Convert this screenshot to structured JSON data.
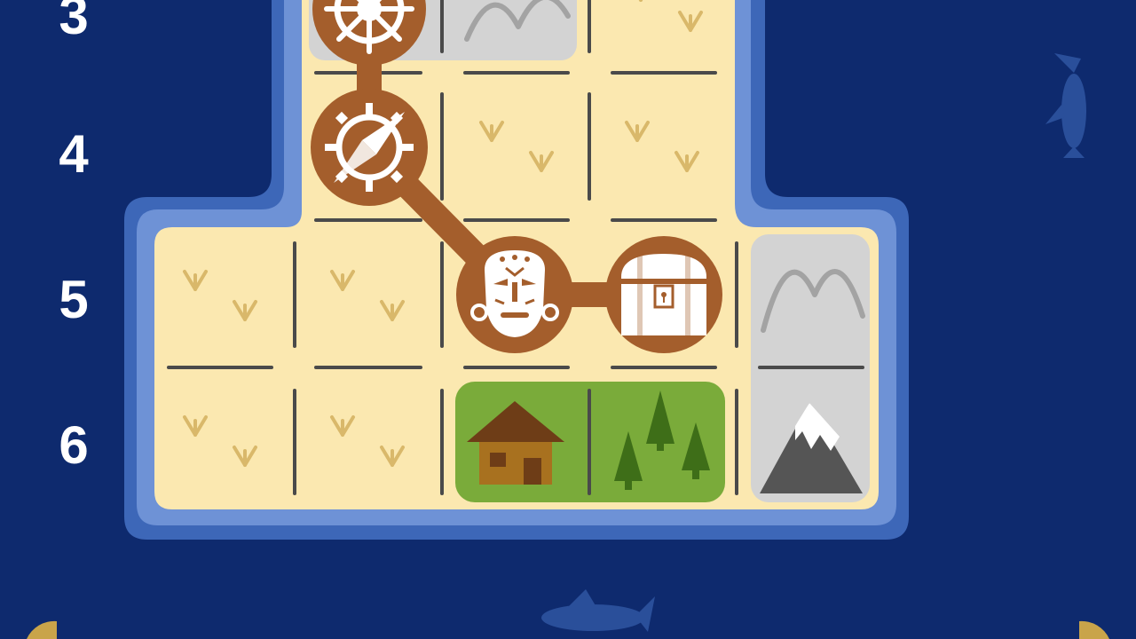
{
  "row_labels": [
    "3",
    "4",
    "5",
    "6"
  ],
  "board": {
    "grid_tiles": [
      {
        "row": "3",
        "col": 2,
        "terrain": "grass"
      },
      {
        "row": "4",
        "col": 2,
        "terrain": "grass"
      },
      {
        "row": "4",
        "col": 3,
        "terrain": "grass"
      },
      {
        "row": "5",
        "col": 0,
        "terrain": "grass"
      },
      {
        "row": "5",
        "col": 1,
        "terrain": "grass"
      },
      {
        "row": "6",
        "col": 0,
        "terrain": "grass"
      },
      {
        "row": "6",
        "col": 1,
        "terrain": "grass"
      }
    ],
    "regions": [
      {
        "name": "mountains",
        "terrain": "mountain",
        "color": "#d3d3d3"
      },
      {
        "name": "forest",
        "terrain": "forest",
        "color": "#7aab3a"
      }
    ],
    "path_nodes": [
      {
        "row": "3",
        "col": 0,
        "icon": "ships-wheel-icon"
      },
      {
        "row": "4",
        "col": 0,
        "icon": "compass-icon"
      },
      {
        "row": "5",
        "col": 2,
        "icon": "tribal-mask-icon"
      },
      {
        "row": "5",
        "col": 3,
        "icon": "treasure-chest-icon"
      }
    ],
    "landmarks": [
      {
        "icon": "hut-icon"
      },
      {
        "icon": "pine-trees-icon"
      },
      {
        "icon": "snowy-mountain-icon"
      }
    ]
  },
  "colors": {
    "ocean": "#0e2a6e",
    "sand": "#fbe8b0",
    "path": "#a45e2c",
    "border_outer": "#3d67b8",
    "border_inner": "#6e92d6",
    "grass_tuft": "#d9b86a",
    "grid_line": "#4a4a4a",
    "fish": "#2a4f9a",
    "corner_button": "#c9a44a"
  }
}
